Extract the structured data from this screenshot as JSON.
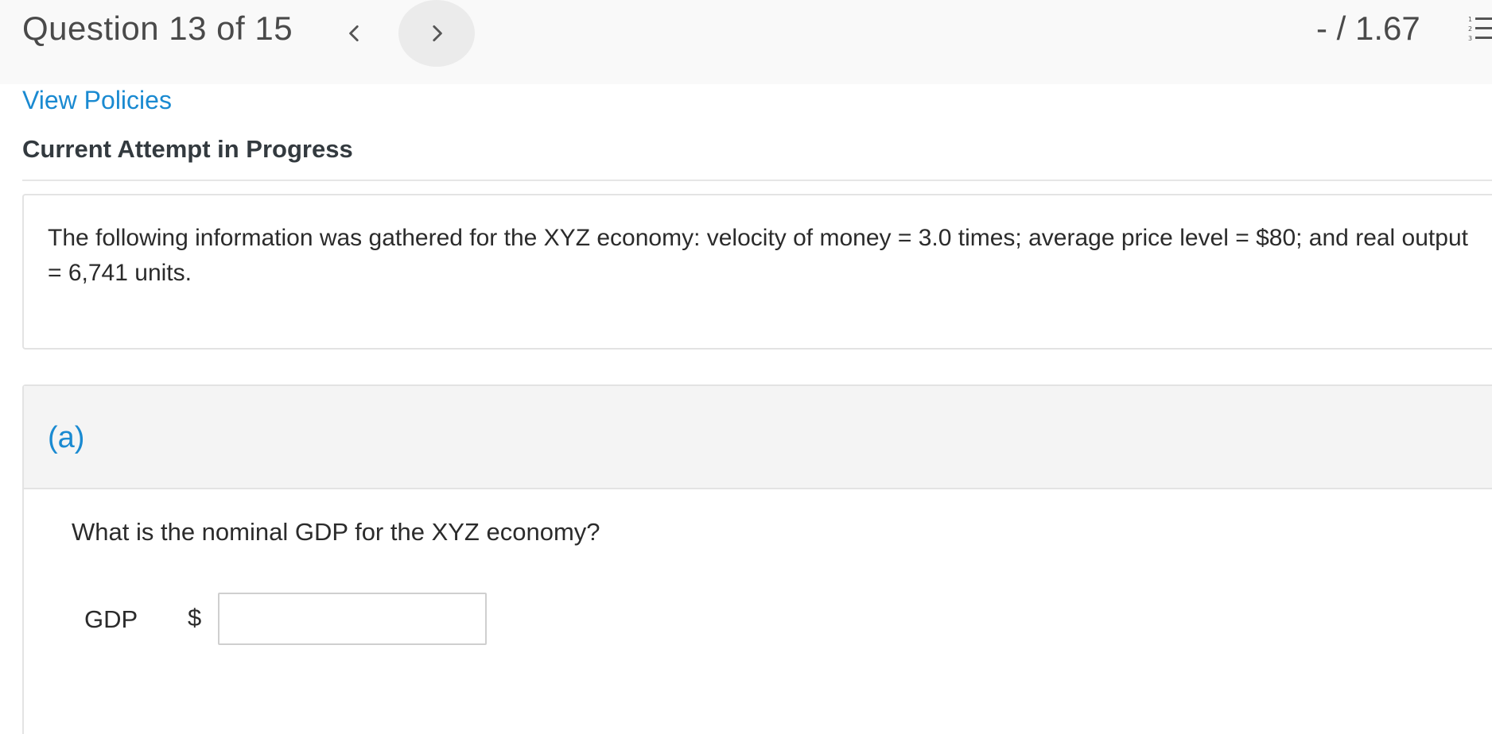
{
  "header": {
    "question_counter": "Question 13 of 15",
    "score": "- / 1.67",
    "prev_icon": "chevron-left-icon",
    "next_icon": "chevron-right-icon",
    "list_icon": "numbered-list-icon"
  },
  "policies_link": "View Policies",
  "attempt_status": "Current Attempt in Progress",
  "problem": {
    "text": "The following information was gathered for the XYZ economy: velocity of money = 3.0 times; average price level = $80; and real output = 6,741 units."
  },
  "part_a": {
    "label": "(a)",
    "question": "What is the nominal GDP for the XYZ economy?",
    "field_label": "GDP",
    "currency_symbol": "$",
    "input_value": ""
  },
  "colors": {
    "link_blue": "#1a8ad1",
    "header_bg": "#f9f9f9",
    "part_header_bg": "#f4f4f4"
  }
}
